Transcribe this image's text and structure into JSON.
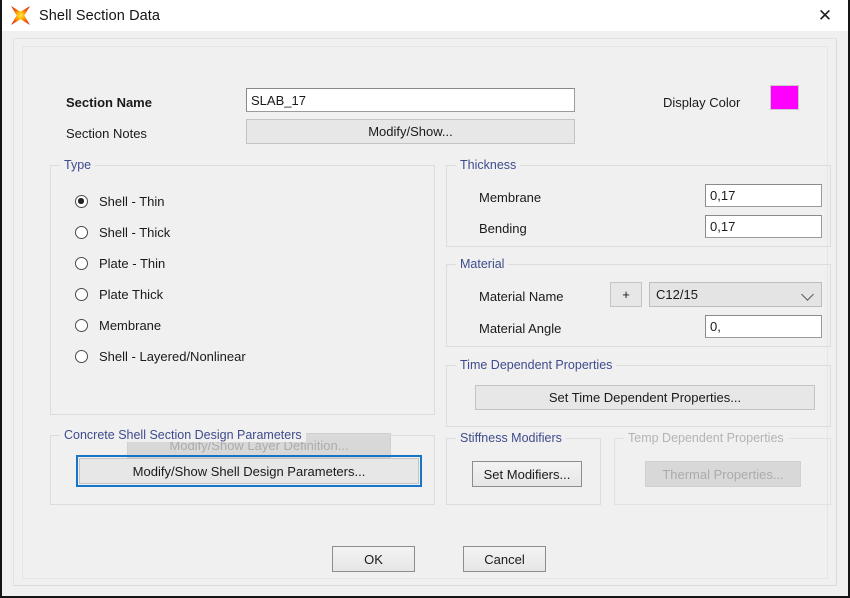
{
  "window": {
    "title": "Shell Section Data",
    "icon": "csi-star-icon",
    "close_label": "✕"
  },
  "header": {
    "section_name_label": "Section Name",
    "section_name_value": "SLAB_17",
    "section_notes_label": "Section Notes",
    "section_notes_button": "Modify/Show...",
    "display_color_label": "Display Color",
    "display_color_value": "#FF00FF"
  },
  "type_group": {
    "title": "Type",
    "options": [
      {
        "label": "Shell - Thin",
        "selected": true
      },
      {
        "label": "Shell - Thick",
        "selected": false
      },
      {
        "label": "Plate - Thin",
        "selected": false
      },
      {
        "label": "Plate Thick",
        "selected": false
      },
      {
        "label": "Membrane",
        "selected": false
      },
      {
        "label": "Shell - Layered/Nonlinear",
        "selected": false
      }
    ],
    "layer_button": "Modify/Show Layer Definition...",
    "layer_button_enabled": false
  },
  "thickness_group": {
    "title": "Thickness",
    "membrane_label": "Membrane",
    "membrane_value": "0,17",
    "bending_label": "Bending",
    "bending_value": "0,17"
  },
  "material_group": {
    "title": "Material",
    "material_name_label": "Material Name",
    "add_button": "+",
    "material_name_value": "C12/15",
    "material_angle_label": "Material Angle",
    "material_angle_value": "0,"
  },
  "time_dependent_group": {
    "title": "Time Dependent Properties",
    "button": "Set Time Dependent Properties..."
  },
  "concrete_design_group": {
    "title": "Concrete Shell Section Design Parameters",
    "button": "Modify/Show Shell Design Parameters...",
    "button_focused": true
  },
  "stiffness_group": {
    "title": "Stiffness Modifiers",
    "button": "Set Modifiers..."
  },
  "temp_group": {
    "title": "Temp Dependent Properties",
    "button": "Thermal Properties...",
    "enabled": false
  },
  "footer": {
    "ok_label": "OK",
    "cancel_label": "Cancel"
  },
  "colors": {
    "group_label": "#3f4c8c",
    "focus_border": "#1675c8",
    "dialog_bg": "#f0f0f0"
  }
}
